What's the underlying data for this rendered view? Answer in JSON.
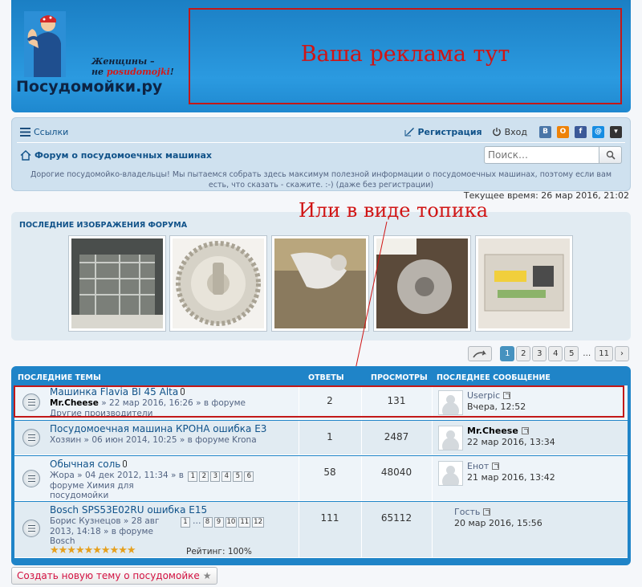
{
  "header": {
    "site_name": "Посудомойки.ру",
    "tagline_line1": "Женщины –",
    "tagline_line2_prefix": "не ",
    "tagline_line2_brand": "posudomojki",
    "tagline_line2_suffix": "!",
    "ad_text": "Ваша реклама тут"
  },
  "navbar": {
    "links_label": "Ссылки",
    "register_label": "Регистрация",
    "login_label": "Вход",
    "forum_title": "Форум о посудомоечных машинах",
    "search_placeholder": "Поиск…",
    "notice": "Дорогие посудомойко-владельцы! Мы пытаемся собрать здесь максимум полезной информации о посудомоечных машинах, поэтому если вам есть, что сказать - скажите. :-) (даже без регистрации)",
    "social": [
      {
        "label": "В",
        "color": "#4a76a8"
      },
      {
        "label": "О",
        "color": "#ee8208"
      },
      {
        "label": "f",
        "color": "#3b5998"
      },
      {
        "label": "@",
        "color": "#168de2"
      },
      {
        "label": "▾",
        "color": "#333333"
      }
    ]
  },
  "current_time": "Текущее время: 26 мар 2016, 21:02",
  "images_block": {
    "title": "ПОСЛЕДНИЕ ИЗОБРАЖЕНИЯ ФОРУМА"
  },
  "annotation": "Или в виде топика",
  "pagination": {
    "pages": [
      "1",
      "2",
      "3",
      "4",
      "5"
    ],
    "ellipsis": "…",
    "last": "11",
    "next": "›"
  },
  "topics": {
    "headers": {
      "topics": "ПОСЛЕДНИЕ ТЕМЫ",
      "replies": "ОТВЕТЫ",
      "views": "ПРОСМОТРЫ",
      "last_post": "ПОСЛЕДНЕЕ СООБЩЕНИЕ"
    },
    "rows": [
      {
        "title": "Машинка Flavia BI 45 Alta",
        "author": "Mr.Cheese",
        "meta": " » 22 мар 2016, 16:26 » в форуме",
        "meta2": "Другие производители",
        "replies": "2",
        "views": "131",
        "last_user": "Userpic",
        "last_date": "Вчера, 12:52"
      },
      {
        "title": "Посудомоечная машина КРОНА ошибка E3",
        "author": "Хозяин",
        "meta": " » 06 июн 2014, 10:25 » в форуме Krona",
        "replies": "1",
        "views": "2487",
        "last_user": "Mr.Cheese",
        "last_date": "22 мар 2016, 13:34"
      },
      {
        "title": "Обычная соль",
        "author": "Жора",
        "meta": " » 04 дек 2012, 11:34 » в",
        "meta2": "форуме Химия для",
        "meta3": "посудомойки",
        "mini_pages": [
          "1",
          "2",
          "3",
          "4",
          "5",
          "6"
        ],
        "replies": "58",
        "views": "48040",
        "last_user": "Енот",
        "last_date": "21 мар 2016, 13:42"
      },
      {
        "title": "Bosch SPS53E02RU ошибка E15",
        "author": "Борис Кузнецов",
        "meta": " » 28 авг",
        "meta2": "2013, 14:18 » в форуме",
        "meta3": "Bosch",
        "mini_pages": [
          "1",
          "…",
          "8",
          "9",
          "10",
          "11",
          "12"
        ],
        "stars": "★★★★★★★★★★",
        "rating": "Рейтинг: 100%",
        "replies": "111",
        "views": "65112",
        "last_user": "Гость",
        "last_date": "20 мар 2016, 15:56"
      }
    ]
  },
  "new_topic_label": "Создать новую тему о посудомойке"
}
